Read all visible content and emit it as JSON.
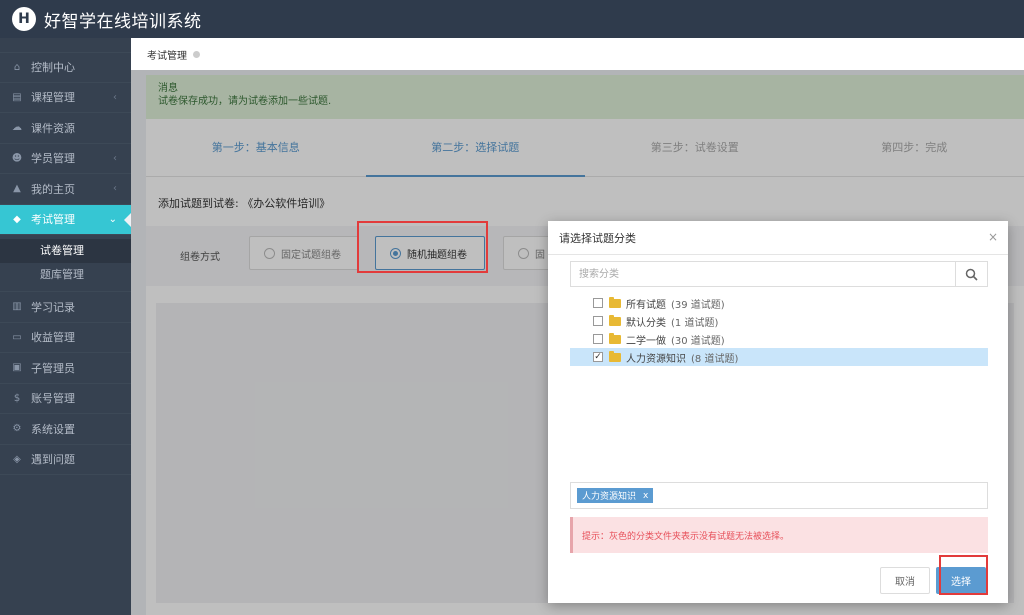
{
  "header": {
    "logo_letter": "H",
    "app_title": "好智学在线培训系统"
  },
  "sidebar": {
    "items": [
      {
        "label": "控制中心",
        "icon": "home-icon",
        "has_arrow": false
      },
      {
        "label": "课程管理",
        "icon": "book-icon",
        "has_arrow": true
      },
      {
        "label": "课件资源",
        "icon": "cloud-icon",
        "has_arrow": false
      },
      {
        "label": "学员管理",
        "icon": "users-icon",
        "has_arrow": true
      },
      {
        "label": "我的主页",
        "icon": "graduation-cap-icon",
        "has_arrow": true
      },
      {
        "label": "考试管理",
        "icon": "tag-icon",
        "has_arrow": true,
        "active": true
      },
      {
        "label": "学习记录",
        "icon": "notebook-icon",
        "has_arrow": false
      },
      {
        "label": "收益管理",
        "icon": "credit-card-icon",
        "has_arrow": false
      },
      {
        "label": "子管理员",
        "icon": "lock-icon",
        "has_arrow": false
      },
      {
        "label": "账号管理",
        "icon": "dollar-icon",
        "has_arrow": false
      },
      {
        "label": "系统设置",
        "icon": "gear-icon",
        "has_arrow": false
      },
      {
        "label": "遇到问题",
        "icon": "diamond-icon",
        "has_arrow": false
      }
    ],
    "sub_items": [
      {
        "label": "试卷管理",
        "current": true
      },
      {
        "label": "题库管理",
        "current": false
      }
    ]
  },
  "breadcrumb": {
    "label": "考试管理"
  },
  "alert": {
    "title": "消息",
    "message": "试卷保存成功，请为试卷添加一些试题."
  },
  "steps": [
    {
      "label": "第一步：基本信息",
      "state": "done"
    },
    {
      "label": "第二步：选择试题",
      "state": "on"
    },
    {
      "label": "第三步：试卷设置",
      "state": "todo"
    },
    {
      "label": "第四步：完成",
      "state": "todo"
    }
  ],
  "panel": {
    "section_title": "添加试题到试卷: 《办公软件培训》",
    "mode_label": "组卷方式",
    "modes": [
      {
        "label": "固定试题组卷",
        "selected": false
      },
      {
        "label": "随机抽题组卷",
        "selected": true
      },
      {
        "label": "固",
        "selected": false
      }
    ]
  },
  "modal": {
    "title": "请选择试题分类",
    "close": "×",
    "search_placeholder": "搜索分类",
    "tree": [
      {
        "name": "所有试题",
        "count": "(39 道试题)",
        "checked": false
      },
      {
        "name": "默认分类",
        "count": "(1 道试题)",
        "checked": false
      },
      {
        "name": "二学一做",
        "count": "(30 道试题)",
        "checked": false
      },
      {
        "name": "人力资源知识",
        "count": "(8 道试题)",
        "checked": true
      }
    ],
    "selected_tag": "人力资源知识",
    "tag_remove": "x",
    "hint": "提示：灰色的分类文件夹表示没有试题无法被选择。",
    "cancel_label": "取消",
    "select_label": "选择"
  },
  "colors": {
    "accent": "#5b9bd1",
    "sidebar_bg": "#364150",
    "active_item": "#36c6d3",
    "highlight_box": "#e23b3b"
  }
}
